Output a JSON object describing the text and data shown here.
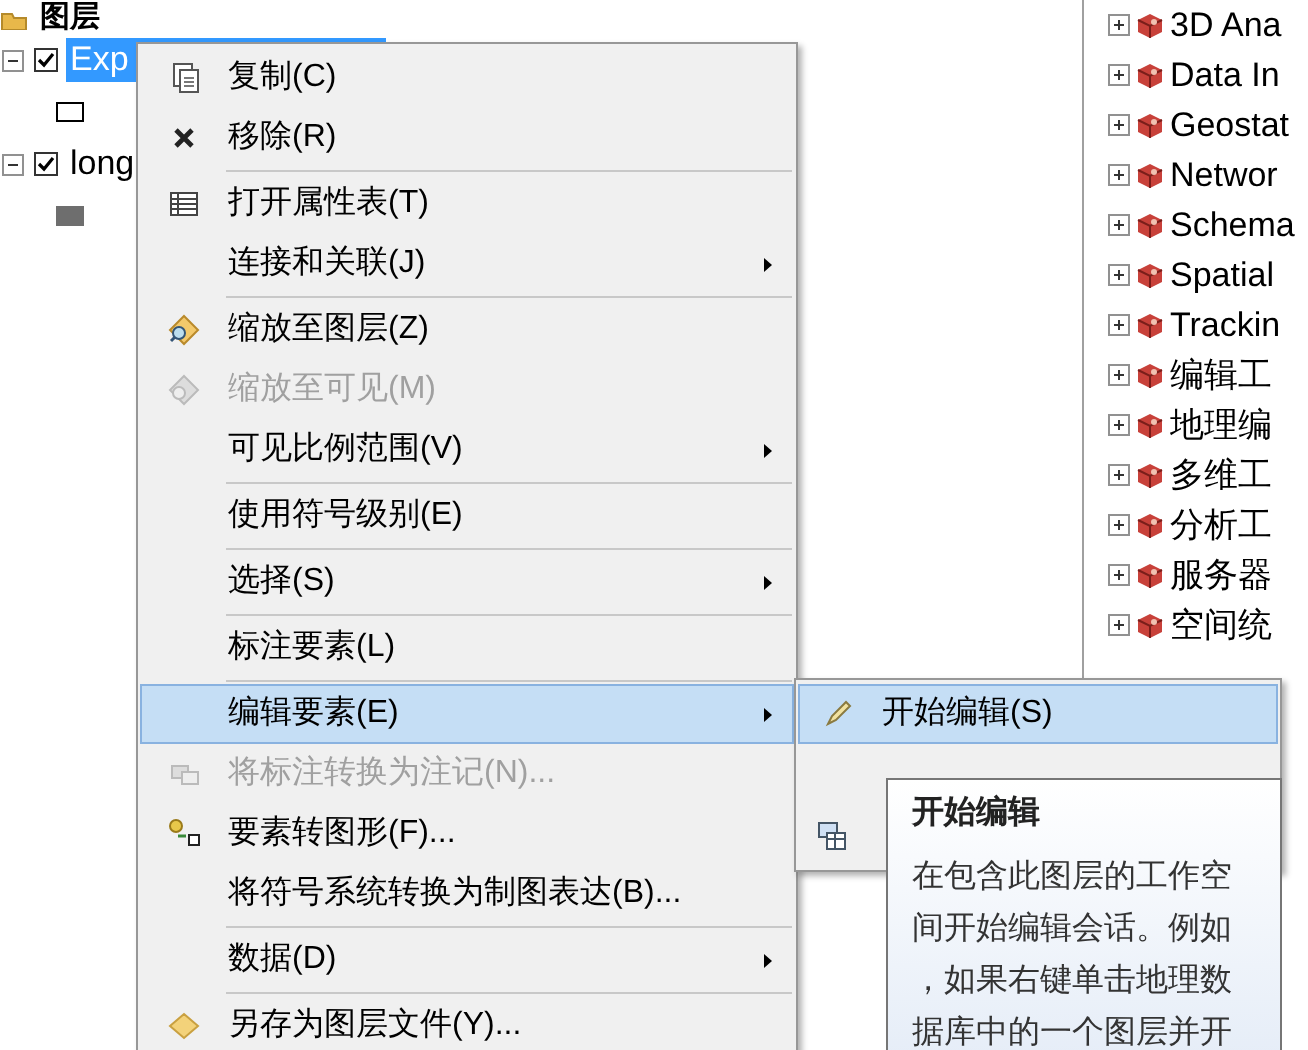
{
  "layers_panel": {
    "title": "图层",
    "layers": [
      {
        "label": "Exp",
        "checked": true,
        "expanded": true,
        "selected": true,
        "filled_symbol": false
      },
      {
        "label": "long",
        "checked": true,
        "expanded": true,
        "selected": false,
        "filled_symbol": true
      }
    ]
  },
  "toolbox_tree": {
    "items": [
      {
        "label": "3D Ana",
        "expanded": false
      },
      {
        "label": "Data In",
        "expanded": false
      },
      {
        "label": "Geostat",
        "expanded": false
      },
      {
        "label": "Networ",
        "expanded": false
      },
      {
        "label": "Schema",
        "expanded": false
      },
      {
        "label": "Spatial",
        "expanded": false
      },
      {
        "label": "Trackin",
        "expanded": false
      },
      {
        "label": "编辑工",
        "expanded": false
      },
      {
        "label": "地理编",
        "expanded": false
      },
      {
        "label": "多维工",
        "expanded": false
      },
      {
        "label": "分析工",
        "expanded": false
      },
      {
        "label": "服务器",
        "expanded": false
      },
      {
        "label": "空间统",
        "expanded": false
      }
    ]
  },
  "context_menu": {
    "items": [
      {
        "label": "复制(C)",
        "disabled": false,
        "submenu": false,
        "selected": false,
        "separator_above": false
      },
      {
        "label": "移除(R)",
        "disabled": false,
        "submenu": false,
        "selected": false,
        "separator_above": false
      },
      {
        "label": "打开属性表(T)",
        "disabled": false,
        "submenu": false,
        "selected": false,
        "separator_above": true
      },
      {
        "label": "连接和关联(J)",
        "disabled": false,
        "submenu": true,
        "selected": false,
        "separator_above": false
      },
      {
        "label": "缩放至图层(Z)",
        "disabled": false,
        "submenu": false,
        "selected": false,
        "separator_above": true
      },
      {
        "label": "缩放至可见(M)",
        "disabled": true,
        "submenu": false,
        "selected": false,
        "separator_above": false
      },
      {
        "label": "可见比例范围(V)",
        "disabled": false,
        "submenu": true,
        "selected": false,
        "separator_above": false
      },
      {
        "label": "使用符号级别(E)",
        "disabled": false,
        "submenu": false,
        "selected": false,
        "separator_above": true
      },
      {
        "label": "选择(S)",
        "disabled": false,
        "submenu": true,
        "selected": false,
        "separator_above": true
      },
      {
        "label": "标注要素(L)",
        "disabled": false,
        "submenu": false,
        "selected": false,
        "separator_above": true
      },
      {
        "label": "编辑要素(E)",
        "disabled": false,
        "submenu": true,
        "selected": true,
        "separator_above": true
      },
      {
        "label": "将标注转换为注记(N)...",
        "disabled": true,
        "submenu": false,
        "selected": false,
        "separator_above": false
      },
      {
        "label": "要素转图形(F)...",
        "disabled": false,
        "submenu": false,
        "selected": false,
        "separator_above": false
      },
      {
        "label": "将符号系统转换为制图表达(B)...",
        "disabled": false,
        "submenu": false,
        "selected": false,
        "separator_above": false
      },
      {
        "label": "数据(D)",
        "disabled": false,
        "submenu": true,
        "selected": false,
        "separator_above": true
      },
      {
        "label": "另存为图层文件(Y)...",
        "disabled": false,
        "submenu": false,
        "selected": false,
        "separator_above": true
      }
    ]
  },
  "submenu": {
    "items": [
      {
        "label": "开始编辑(S)",
        "selected": true
      }
    ]
  },
  "tooltip": {
    "title": "开始编辑",
    "lines": [
      "在包含此图层的工作空",
      "间开始编辑会话。例如",
      "，如果右键单击地理数",
      "据库中的一个图层并开"
    ]
  }
}
